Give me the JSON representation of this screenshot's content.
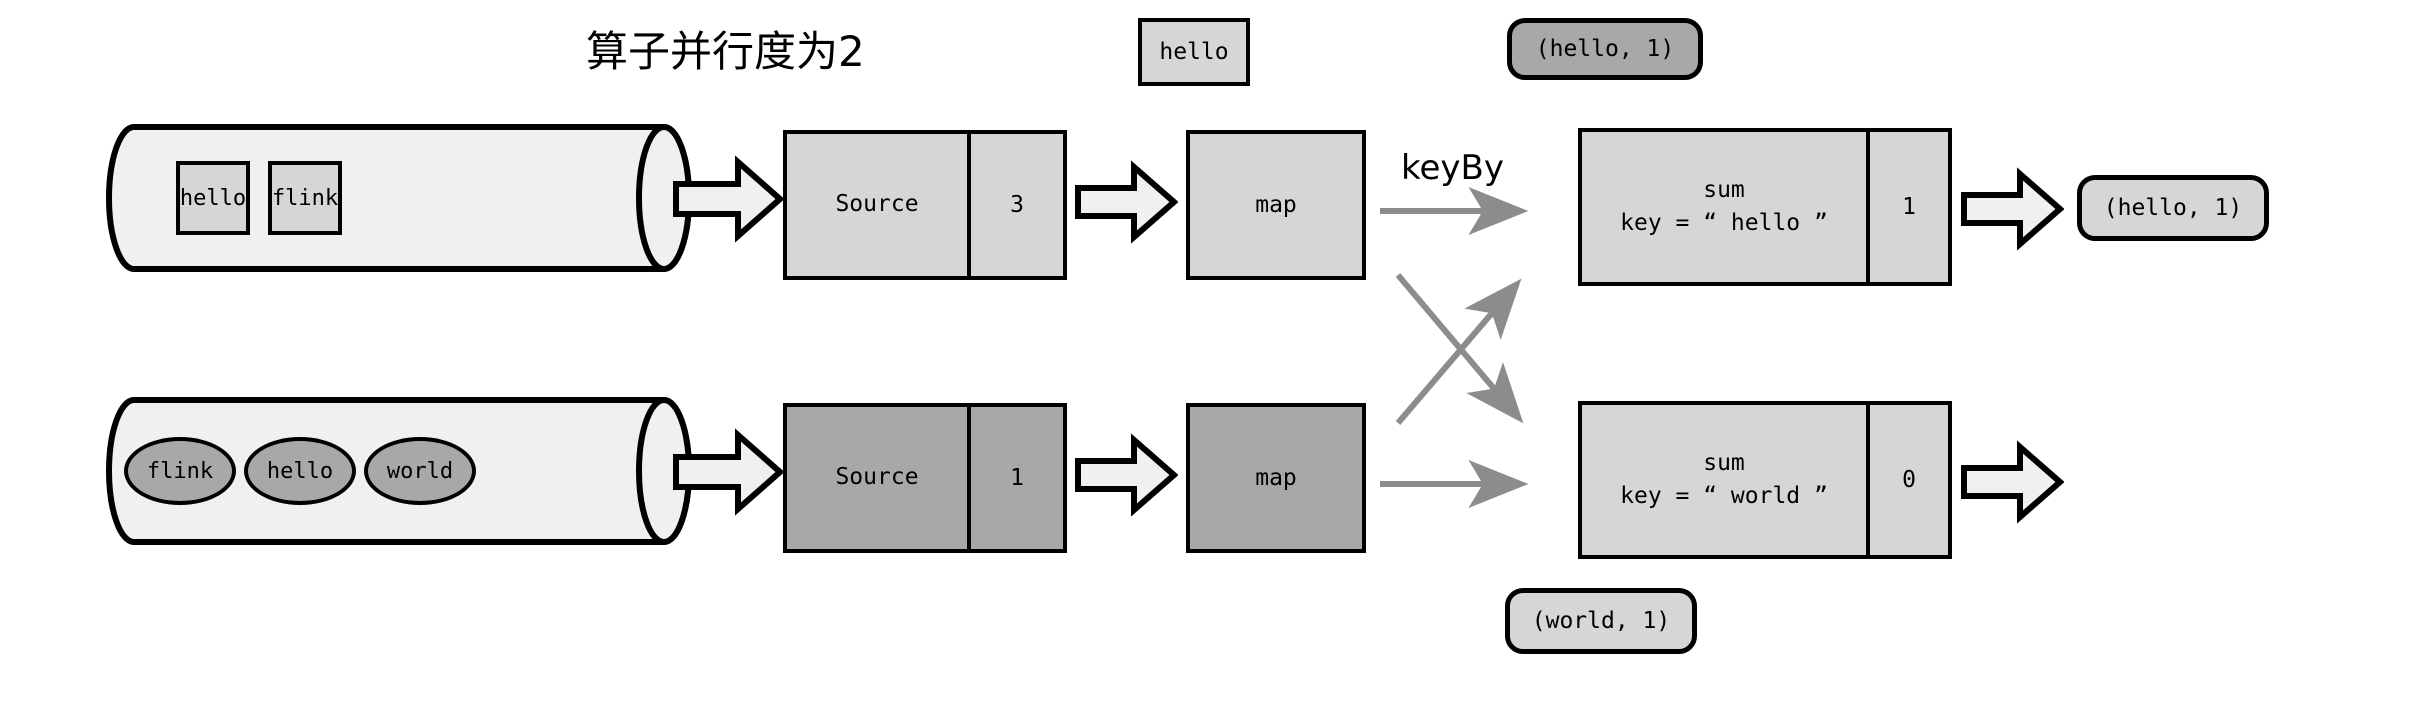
{
  "diagram": {
    "title": "算子并行度为2",
    "keyby_label": "keyBy"
  },
  "streams": [
    {
      "name": "upper-stream",
      "items": [
        {
          "label": "hello"
        },
        {
          "label": "flink"
        }
      ]
    },
    {
      "name": "lower-stream",
      "items": [
        {
          "label": "flink"
        },
        {
          "label": "hello"
        },
        {
          "label": "world"
        }
      ]
    }
  ],
  "sources": [
    {
      "label": "Source",
      "count": "3"
    },
    {
      "label": "Source",
      "count": "1"
    }
  ],
  "maps": [
    {
      "label": "map"
    },
    {
      "label": "map"
    }
  ],
  "sums": [
    {
      "line1": "sum",
      "line2": "key = “ hello ”",
      "count": "1"
    },
    {
      "line1": "sum",
      "line2": "key = “ world ”",
      "count": "0"
    }
  ],
  "records": {
    "source_record": "hello",
    "keyed_record": "(hello, 1)",
    "output_hello": "(hello, 1)",
    "output_world": "(world, 1)"
  },
  "colors": {
    "outline": "#000000",
    "fill_light": "#d6d6d6",
    "fill_dark": "#a8a8a8",
    "cylinder_fill": "#f0f0f0",
    "arrow_fill": "#f0f0f0",
    "thin_arrow": "#8c8c8c",
    "background": "#ffffff"
  }
}
